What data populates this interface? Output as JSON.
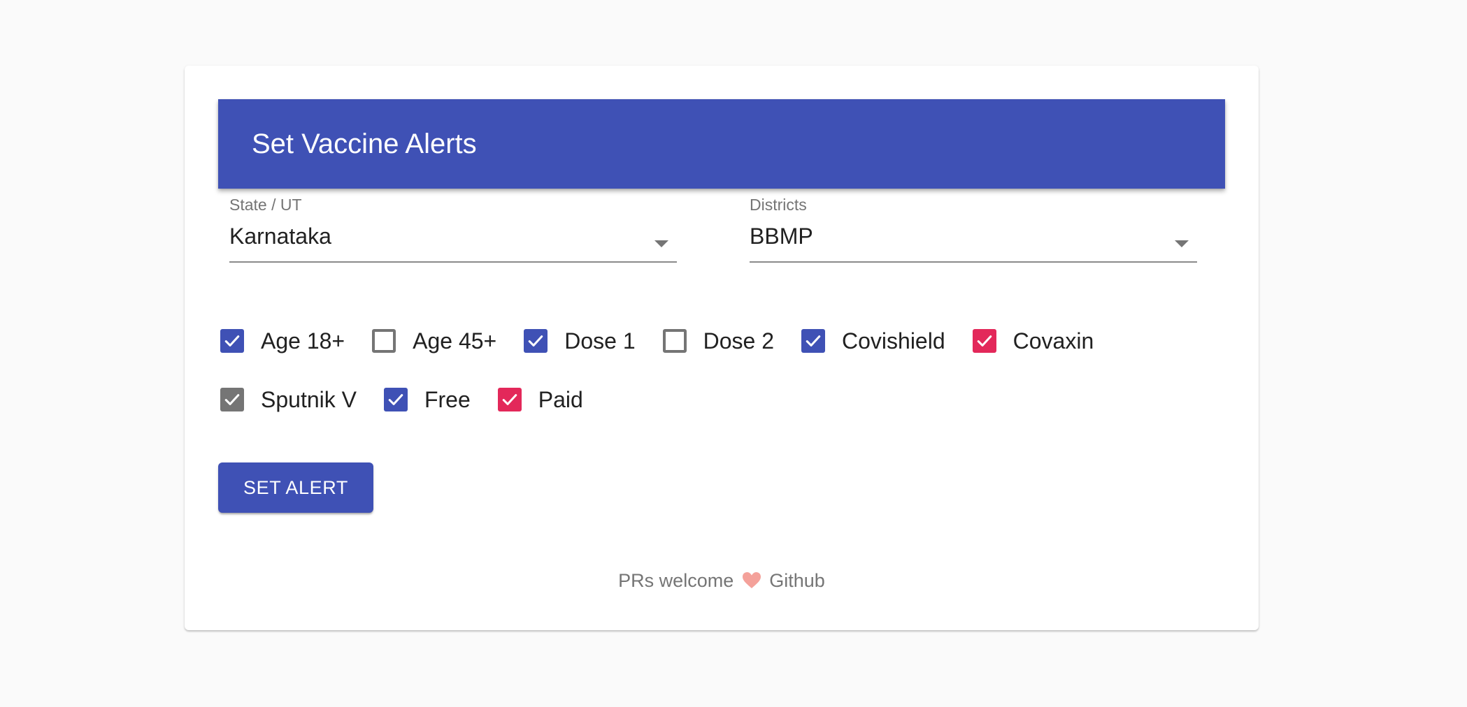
{
  "colors": {
    "primary": "#3f51b5",
    "secondary": "#e3285a",
    "default": "#757575",
    "background": "#fafafa"
  },
  "header": {
    "title": "Set Vaccine Alerts"
  },
  "state_field": {
    "label": "State / UT",
    "value": "Karnataka"
  },
  "district_field": {
    "label": "Districts",
    "value": "BBMP"
  },
  "checkboxes": [
    {
      "label": "Age 18+",
      "checked": true,
      "color": "primary"
    },
    {
      "label": "Age 45+",
      "checked": false,
      "color": "primary"
    },
    {
      "label": "Dose 1",
      "checked": true,
      "color": "primary"
    },
    {
      "label": "Dose 2",
      "checked": false,
      "color": "primary"
    },
    {
      "label": "Covishield",
      "checked": true,
      "color": "primary"
    },
    {
      "label": "Covaxin",
      "checked": true,
      "color": "secondary"
    },
    {
      "label": "Sputnik V",
      "checked": true,
      "color": "default"
    },
    {
      "label": "Free",
      "checked": true,
      "color": "primary"
    },
    {
      "label": "Paid",
      "checked": true,
      "color": "secondary"
    }
  ],
  "button": {
    "label": "SET ALERT"
  },
  "footer": {
    "text": "PRs welcome",
    "link": "Github",
    "icon": "heart-icon"
  }
}
